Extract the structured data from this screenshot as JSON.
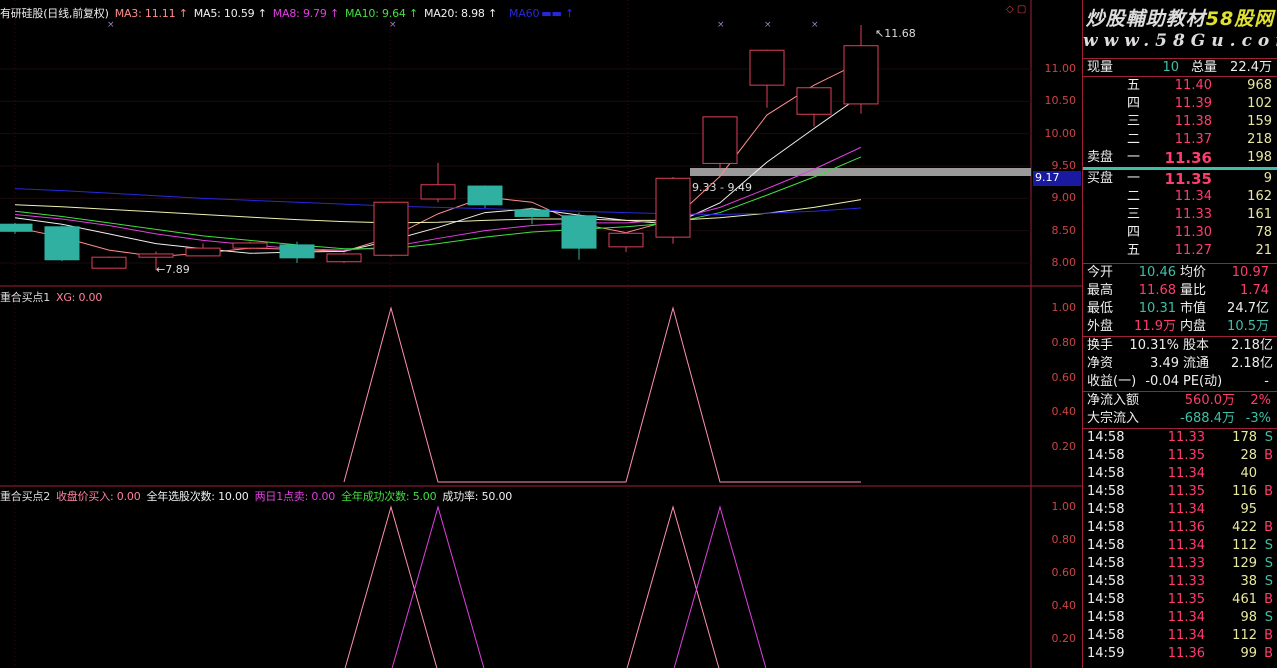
{
  "header": {
    "title": "有研硅股(日线,前复权)",
    "ma": [
      {
        "label": "MA3: 11.11",
        "color": "#ff8c8c"
      },
      {
        "label": "MA5: 10.59",
        "color": "#f0f0f0"
      },
      {
        "label": "MA8: 9.79",
        "color": "#e040e0"
      },
      {
        "label": "MA10: 9.64",
        "color": "#40e040"
      },
      {
        "label": "MA20: 8.98",
        "color": "#f0f0f0"
      }
    ],
    "ma60_color": "#2020d0"
  },
  "price_axis": [
    "11.00",
    "10.50",
    "10.00",
    "9.50",
    "9.00",
    "8.50",
    "8.00"
  ],
  "price_levels": [
    11,
    10.5,
    10,
    9.5,
    9,
    8.5,
    8
  ],
  "candles": [
    {
      "o": 8.6,
      "c": 8.49,
      "h": 8.62,
      "l": 8.45
    },
    {
      "o": 8.56,
      "c": 8.05,
      "h": 8.58,
      "l": 8.03
    },
    {
      "o": 7.92,
      "c": 8.09,
      "h": 8.1,
      "l": 7.92
    },
    {
      "o": 8.09,
      "c": 8.14,
      "h": 8.18,
      "l": 7.89
    },
    {
      "o": 8.11,
      "c": 8.23,
      "h": 8.3,
      "l": 8.1
    },
    {
      "o": 8.23,
      "c": 8.31,
      "h": 8.33,
      "l": 8.21
    },
    {
      "o": 8.28,
      "c": 8.08,
      "h": 8.33,
      "l": 8.0
    },
    {
      "o": 8.02,
      "c": 8.14,
      "h": 8.16,
      "l": 8.0
    },
    {
      "o": 8.12,
      "c": 8.94,
      "h": 8.95,
      "l": 8.1
    },
    {
      "o": 8.99,
      "c": 9.21,
      "h": 9.55,
      "l": 8.94
    },
    {
      "o": 9.19,
      "c": 8.9,
      "h": 9.2,
      "l": 8.85
    },
    {
      "o": 8.82,
      "c": 8.72,
      "h": 8.86,
      "l": 8.6
    },
    {
      "o": 8.73,
      "c": 8.23,
      "h": 8.78,
      "l": 8.05
    },
    {
      "o": 8.25,
      "c": 8.46,
      "h": 8.48,
      "l": 8.17
    },
    {
      "o": 8.4,
      "c": 9.31,
      "h": 9.33,
      "l": 8.3
    },
    {
      "o": 9.54,
      "c": 10.26,
      "h": 10.27,
      "l": 9.46
    },
    {
      "o": 10.75,
      "c": 11.29,
      "h": 11.3,
      "l": 10.4
    },
    {
      "o": 10.3,
      "c": 10.71,
      "h": 10.72,
      "l": 10.11
    },
    {
      "o": 10.46,
      "c": 11.36,
      "h": 11.68,
      "l": 10.31
    }
  ],
  "ma_series": [
    {
      "name": "MA3",
      "color": "#ff8c8c",
      "values": [
        8.55,
        8.4,
        8.2,
        8.1,
        8.15,
        8.23,
        8.21,
        8.18,
        8.4,
        8.76,
        9.02,
        8.94,
        8.61,
        8.47,
        8.67,
        9.34,
        10.29,
        10.75,
        11.11
      ]
    },
    {
      "name": "MA5",
      "color": "#f0f0f0",
      "values": [
        8.7,
        8.6,
        8.45,
        8.3,
        8.22,
        8.15,
        8.17,
        8.18,
        8.35,
        8.55,
        8.78,
        8.84,
        8.74,
        8.66,
        8.6,
        8.93,
        9.56,
        10.08,
        10.59
      ]
    },
    {
      "name": "MA8",
      "color": "#e040e0",
      "values": [
        8.75,
        8.68,
        8.58,
        8.45,
        8.35,
        8.28,
        8.22,
        8.2,
        8.25,
        8.38,
        8.5,
        8.58,
        8.62,
        8.62,
        8.67,
        8.86,
        9.15,
        9.45,
        9.79
      ]
    },
    {
      "name": "MA10",
      "color": "#40e040",
      "values": [
        8.8,
        8.72,
        8.62,
        8.52,
        8.42,
        8.35,
        8.28,
        8.22,
        8.22,
        8.3,
        8.4,
        8.48,
        8.52,
        8.56,
        8.62,
        8.78,
        9.05,
        9.33,
        9.64
      ]
    },
    {
      "name": "MA20",
      "color": "#f0f0b0",
      "values": [
        8.9,
        8.87,
        8.83,
        8.79,
        8.75,
        8.71,
        8.67,
        8.64,
        8.62,
        8.63,
        8.66,
        8.68,
        8.68,
        8.66,
        8.66,
        8.7,
        8.77,
        8.86,
        8.98
      ]
    },
    {
      "name": "MA60",
      "color": "#2828d8",
      "values": [
        9.15,
        9.12,
        9.08,
        9.04,
        9.0,
        8.97,
        8.94,
        8.91,
        8.88,
        8.86,
        8.84,
        8.82,
        8.8,
        8.78,
        8.76,
        8.75,
        8.77,
        8.8,
        8.85
      ]
    }
  ],
  "annotations": {
    "high": "11.68",
    "low": "7.89",
    "range": "9.33 - 9.49",
    "cursor_price": "9.17"
  },
  "ind1": {
    "label": "重合买点1",
    "xg": "XG: 0.00",
    "axis": [
      "1.00",
      "0.80",
      "0.60",
      "0.40",
      "0.20"
    ],
    "start": 7,
    "values": [
      0,
      0,
      0,
      0,
      0,
      0,
      0,
      0,
      1,
      0,
      0,
      0,
      0,
      0,
      1,
      0,
      0,
      0,
      0
    ],
    "color": "#ff90b0"
  },
  "ind2": {
    "label": "重合买点2",
    "items": [
      {
        "t": "收盘价买入: 0.00",
        "color": "#ff80a0"
      },
      {
        "t": "全年选股次数: 10.00",
        "color": "#f0f0f0"
      },
      {
        "t": "两日1点卖: 0.00",
        "color": "#e040e0"
      },
      {
        "t": "全年成功次数: 5.00",
        "color": "#40e040"
      },
      {
        "t": "成功率: 50.00",
        "color": "#f0f0f0"
      }
    ],
    "axis": [
      "1.00",
      "0.80",
      "0.60",
      "0.40",
      "0.20"
    ],
    "s1": {
      "color": "#ff90b0",
      "values": [
        0,
        0,
        0,
        0,
        0,
        0,
        0,
        0,
        1,
        0,
        0,
        0,
        0,
        0,
        1,
        0,
        0,
        0,
        0
      ]
    },
    "s2": {
      "color": "#e040e0",
      "values": [
        0,
        0,
        0,
        0,
        0,
        0,
        0,
        0,
        0,
        1,
        0,
        0,
        0,
        0,
        0,
        1,
        0,
        0,
        0
      ]
    }
  },
  "panel": {
    "logo1": "炒股輔助教材",
    "logo1b": "58股网",
    "logo2": "www.58Gu.com",
    "now_vol_label": "现量",
    "now_vol": "10",
    "total_vol_label": "总量",
    "total_vol": "22.4万",
    "sell_label": "卖盘",
    "buy_label": "买盘",
    "asks": [
      {
        "l": "五",
        "p": "11.40",
        "v": "968"
      },
      {
        "l": "四",
        "p": "11.39",
        "v": "102"
      },
      {
        "l": "三",
        "p": "11.38",
        "v": "159"
      },
      {
        "l": "二",
        "p": "11.37",
        "v": "218"
      },
      {
        "l": "一",
        "p": "11.36",
        "v": "198"
      }
    ],
    "bids": [
      {
        "l": "一",
        "p": "11.35",
        "v": "9"
      },
      {
        "l": "二",
        "p": "11.34",
        "v": "162"
      },
      {
        "l": "三",
        "p": "11.33",
        "v": "161"
      },
      {
        "l": "四",
        "p": "11.30",
        "v": "78"
      },
      {
        "l": "五",
        "p": "11.27",
        "v": "21"
      }
    ],
    "stats": [
      [
        {
          "k": "今开",
          "v": "10.46",
          "c": "g"
        },
        {
          "k": "均价",
          "v": "10.97",
          "c": "r"
        }
      ],
      [
        {
          "k": "最高",
          "v": "11.68",
          "c": "r"
        },
        {
          "k": "量比",
          "v": "1.74",
          "c": "r"
        }
      ],
      [
        {
          "k": "最低",
          "v": "10.31",
          "c": "g"
        },
        {
          "k": "市值",
          "v": "24.7亿",
          "c": "w"
        }
      ],
      [
        {
          "k": "外盘",
          "v": "11.9万",
          "c": "r"
        },
        {
          "k": "内盘",
          "v": "10.5万",
          "c": "g"
        }
      ]
    ],
    "stats2": [
      [
        {
          "k": "换手",
          "v": "10.31%",
          "c": "w"
        },
        {
          "k": "股本",
          "v": "2.18亿",
          "c": "w"
        }
      ],
      [
        {
          "k": "净资",
          "v": "3.49",
          "c": "w"
        },
        {
          "k": "流通",
          "v": "2.18亿",
          "c": "w"
        }
      ],
      [
        {
          "k": "收益(一)",
          "v": "-0.04",
          "c": "w"
        },
        {
          "k": "PE(动)",
          "v": "-",
          "c": "w"
        }
      ]
    ],
    "flows": [
      {
        "k": "净流入额",
        "v": "560.0万",
        "p": "2%",
        "c": "r"
      },
      {
        "k": "大宗流入",
        "v": "-688.4万",
        "p": "-3%",
        "c": "g"
      }
    ],
    "ticks": [
      [
        "14:58",
        "11.33",
        "178",
        "S"
      ],
      [
        "14:58",
        "11.35",
        "28",
        "B"
      ],
      [
        "14:58",
        "11.34",
        "40",
        ""
      ],
      [
        "14:58",
        "11.35",
        "116",
        "B"
      ],
      [
        "14:58",
        "11.34",
        "95",
        ""
      ],
      [
        "14:58",
        "11.36",
        "422",
        "B"
      ],
      [
        "14:58",
        "11.34",
        "112",
        "S"
      ],
      [
        "14:58",
        "11.33",
        "129",
        "S"
      ],
      [
        "14:58",
        "11.33",
        "38",
        "S"
      ],
      [
        "14:58",
        "11.35",
        "461",
        "B"
      ],
      [
        "14:58",
        "11.34",
        "98",
        "S"
      ],
      [
        "14:58",
        "11.34",
        "112",
        "B"
      ],
      [
        "14:59",
        "11.36",
        "99",
        "B"
      ]
    ]
  }
}
